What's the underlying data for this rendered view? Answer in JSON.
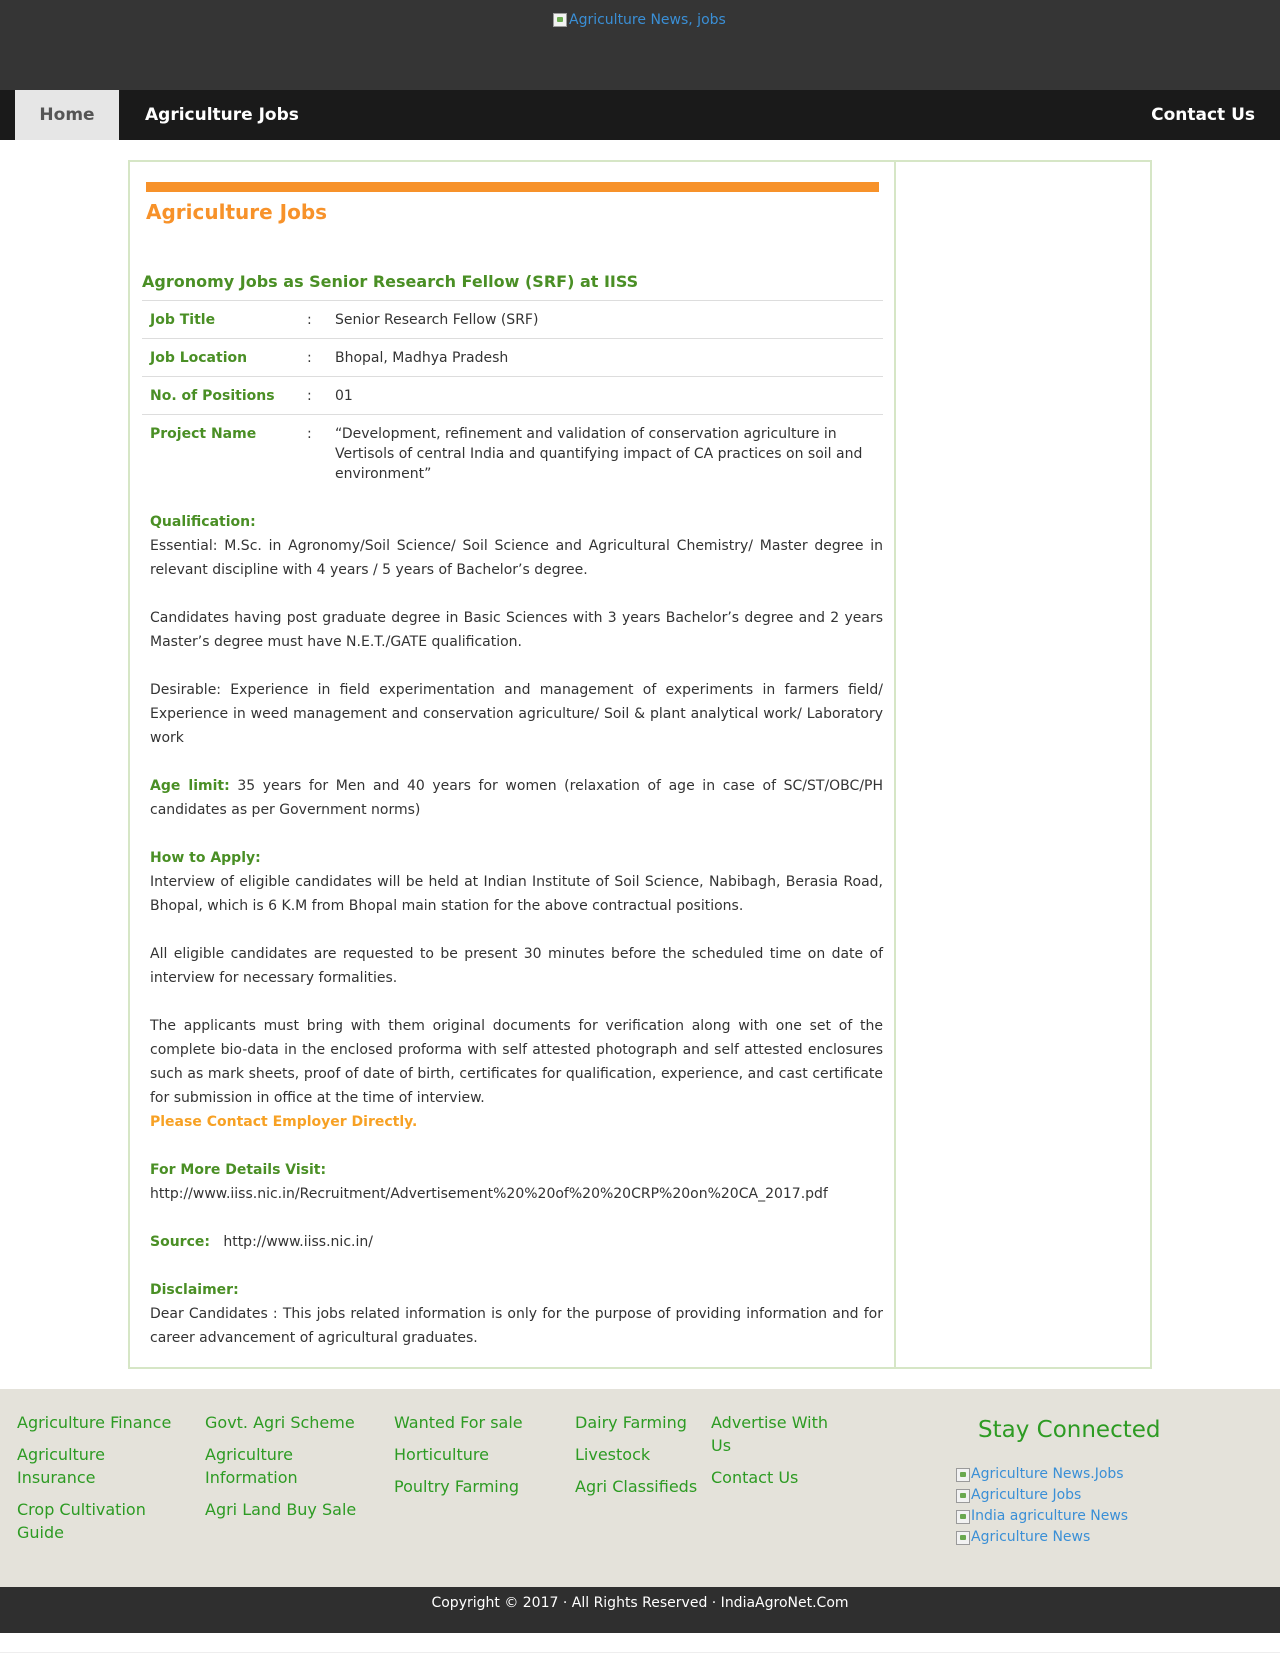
{
  "header": {
    "logo_alt": "Agriculture News, jobs"
  },
  "nav": {
    "home": "Home",
    "jobs": "Agriculture Jobs",
    "contact": "Contact Us"
  },
  "main": {
    "section_title": "Agriculture Jobs",
    "job_heading": "Agronomy Jobs as Senior Research Fellow (SRF) at IISS",
    "rows": [
      {
        "label": "Job Title",
        "sep": ":",
        "value": "Senior Research Fellow (SRF)"
      },
      {
        "label": "Job Location",
        "sep": ":",
        "value": "Bhopal, Madhya Pradesh"
      },
      {
        "label": "No. of Positions",
        "sep": ":",
        "value": "01"
      },
      {
        "label": "Project Name",
        "sep": ":",
        "value": "“Development, refinement and validation of conservation agriculture in Vertisols of central India and quantifying impact of CA practices on soil and environment”"
      }
    ],
    "qualification_label": "Qualification:",
    "essential": "Essential: M.Sc. in Agronomy/Soil Science/ Soil Science and Agricultural Chemistry/ Master degree in relevant discipline with 4 years / 5 years of Bachelor’s degree.",
    "candidates": "Candidates having post graduate degree in Basic Sciences with 3 years Bachelor’s degree and 2 years Master’s degree must have N.E.T./GATE qualification.",
    "desirable": "Desirable: Experience in field experimentation and management of experiments in farmers field/ Experience in weed management and conservation agriculture/ Soil & plant analytical work/ Laboratory work",
    "age_label": "Age limit:",
    "age_text": " 35 years for Men and 40 years for women (relaxation of age in case of SC/ST/OBC/PH candidates as per Government norms)",
    "apply_label": "How to Apply:",
    "apply_text": "Interview of eligible candidates will be held at Indian Institute of Soil Science, Nabibagh, Berasia Road, Bhopal, which is 6 K.M from Bhopal main station for the above contractual positions.",
    "present_text": "All eligible candidates are requested to be present 30 minutes before the scheduled time on date of interview for necessary formalities.",
    "documents_text": "The applicants must bring with them original documents for verification along with one set of the complete bio-data in the enclosed proforma with self attested photograph and self attested enclosures such as mark sheets, proof of date of birth, certificates for qualification, experience, and cast certificate for submission in office at the time of interview.",
    "contact_note": "Please Contact Employer Directly.",
    "details_label": "For More Details Visit:",
    "details_url": "http://www.iiss.nic.in/Recruitment/Advertisement%20%20of%20%20CRP%20on%20CA_2017.pdf",
    "source_label": "Source:",
    "source_url": "http://www.iiss.nic.in/",
    "disclaimer_label": "Disclaimer:",
    "disclaimer_text": "Dear Candidates : This jobs related information is only for the purpose of providing information and for career advancement of agricultural graduates."
  },
  "footer": {
    "col1": [
      "Agriculture Finance",
      "Agriculture Insurance",
      "Crop Cultivation Guide"
    ],
    "col2": [
      "Govt. Agri Scheme",
      "Agriculture Information",
      "Agri Land Buy Sale"
    ],
    "col3": [
      "Wanted For sale",
      "Horticulture",
      "Poultry Farming"
    ],
    "col4": [
      "Dairy Farming",
      "Livestock",
      "Agri Classifieds"
    ],
    "col5": [
      "Advertise With Us",
      "Contact Us"
    ],
    "stay_title": "Stay Connected",
    "stay_links": [
      "Agriculture News.Jobs",
      "Agriculture Jobs",
      "India agriculture News",
      "Agriculture News"
    ],
    "copyright": "Copyright © 2017 · All Rights Reserved · IndiaAgroNet.Com"
  }
}
